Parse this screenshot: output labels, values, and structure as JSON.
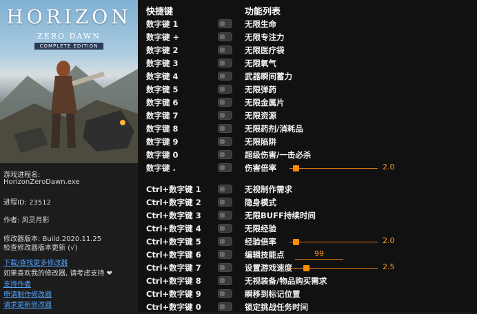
{
  "cover": {
    "title": "HORIZON",
    "subtitle": "ZERO DAWN",
    "edition": "COMPLETE EDITION"
  },
  "info": {
    "process_label": "游戏进程名:",
    "process_value": "HorizonZeroDawn.exe",
    "pid": "进程ID:  23512",
    "author": "作者:  风灵月影",
    "version": "修改器版本:  Build.2020.11.25",
    "check_update": "检查修改器版本更新 (√)",
    "download_link": "下载/查找更多修改器",
    "support_text": "如果喜欢我的修改器, 请考虑支持 ❤",
    "support_link": "支持作者",
    "apply_link": "申请制作修改器",
    "request_link": "请求更新修改器"
  },
  "headers": {
    "hotkey": "快捷键",
    "function": "功能列表"
  },
  "cheats": [
    {
      "key": "数字键 1",
      "name": "无限生命"
    },
    {
      "key": "数字键 +",
      "name": "无限专注力"
    },
    {
      "key": "数字键 2",
      "name": "无限医疗袋"
    },
    {
      "key": "数字键 3",
      "name": "无限氧气"
    },
    {
      "key": "数字键 4",
      "name": "武器瞬间蓄力"
    },
    {
      "key": "数字键 5",
      "name": "无限弹药"
    },
    {
      "key": "数字键 6",
      "name": "无限金属片"
    },
    {
      "key": "数字键 7",
      "name": "无限资源"
    },
    {
      "key": "数字键 8",
      "name": "无限药剂/消耗品"
    },
    {
      "key": "数字键 9",
      "name": "无限陷阱"
    },
    {
      "key": "数字键 0",
      "name": "超级伤害/一击必杀"
    },
    {
      "key": "数字键 .",
      "name": "伤害倍率",
      "value": "2.0",
      "slider_fraction": 0.07
    },
    {
      "key": "Ctrl+数字键 1",
      "name": "无视制作需求"
    },
    {
      "key": "Ctrl+数字键 2",
      "name": "隐身模式"
    },
    {
      "key": "Ctrl+数字键 3",
      "name": "无限BUFF持续时间"
    },
    {
      "key": "Ctrl+数字键 4",
      "name": "无限经验"
    },
    {
      "key": "Ctrl+数字键 5",
      "name": "经验倍率",
      "value": "2.0",
      "slider_fraction": 0.07
    },
    {
      "key": "Ctrl+数字键 6",
      "name": "编辑技能点",
      "value": "99"
    },
    {
      "key": "Ctrl+数字键 7",
      "name": "设置游戏速度",
      "value": "2.5",
      "slider_fraction": 0.19
    },
    {
      "key": "Ctrl+数字键 8",
      "name": "无视装备/物品购买需求"
    },
    {
      "key": "Ctrl+数字键 9",
      "name": "瞬移到标记位置"
    },
    {
      "key": "Ctrl+数字键 0",
      "name": "锁定挑战任务时间"
    }
  ],
  "colors": {
    "accent": "#ff8c00",
    "link": "#4fa3ff",
    "panel_bg": "#111111"
  }
}
